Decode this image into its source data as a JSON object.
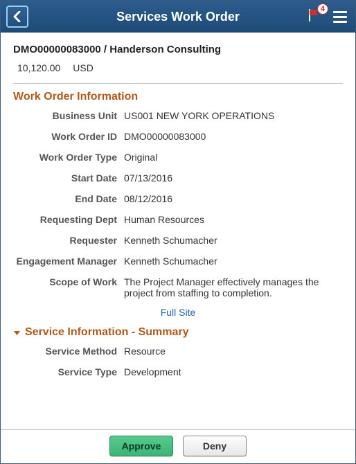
{
  "header": {
    "title": "Services Work Order",
    "notification_count": "4"
  },
  "summary": {
    "title": "DMO00000083000 / Handerson Consulting",
    "amount": "10,120.00",
    "currency": "USD"
  },
  "sections": {
    "work_order_info": {
      "title": "Work Order Information",
      "fields": {
        "business_unit": {
          "label": "Business Unit",
          "value": "US001 NEW YORK OPERATIONS"
        },
        "work_order_id": {
          "label": "Work Order ID",
          "value": "DMO00000083000"
        },
        "work_order_type": {
          "label": "Work Order Type",
          "value": "Original"
        },
        "start_date": {
          "label": "Start Date",
          "value": "07/13/2016"
        },
        "end_date": {
          "label": "End Date",
          "value": "08/12/2016"
        },
        "requesting_dept": {
          "label": "Requesting Dept",
          "value": "Human Resources"
        },
        "requester": {
          "label": "Requester",
          "value": "Kenneth Schumacher"
        },
        "engagement_manager": {
          "label": "Engagement Manager",
          "value": "Kenneth Schumacher"
        },
        "scope_of_work": {
          "label": "Scope of Work",
          "value": "The Project Manager effectively manages the project from staffing to completion."
        }
      }
    },
    "service_info": {
      "title": "Service Information - Summary",
      "fields": {
        "service_method": {
          "label": "Service Method",
          "value": "Resource"
        },
        "service_type": {
          "label": "Service Type",
          "value": "Development"
        }
      }
    }
  },
  "links": {
    "full_site": "Full Site"
  },
  "footer": {
    "approve": "Approve",
    "deny": "Deny"
  }
}
